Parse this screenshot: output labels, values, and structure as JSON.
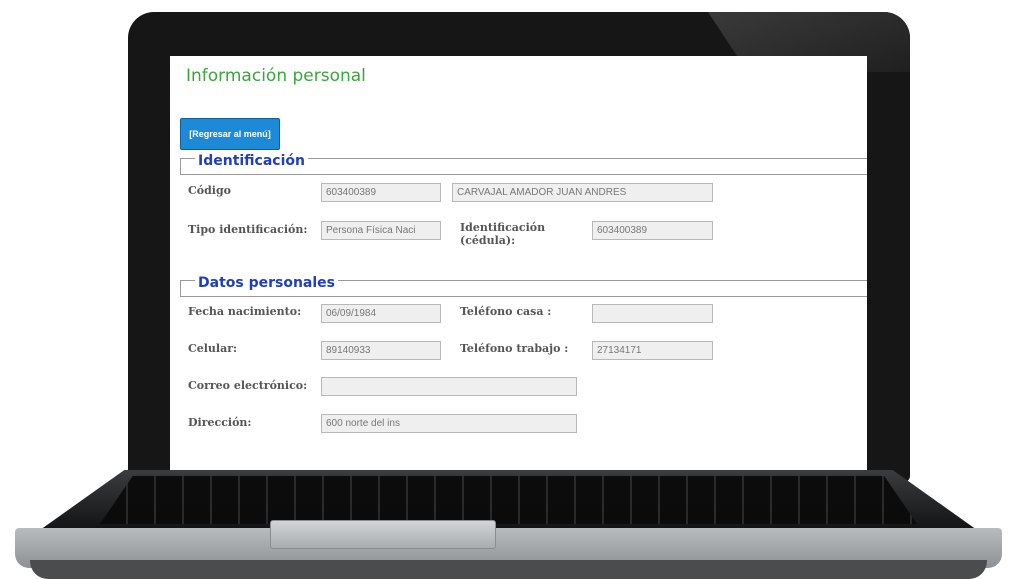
{
  "page": {
    "title": "Información personal",
    "back_button": "[Regresar al menú]"
  },
  "identificacion": {
    "title": "Identificación",
    "codigo_label": "Código",
    "codigo_value": "603400389",
    "nombre_value": "CARVAJAL AMADOR JUAN ANDRES",
    "tipo_label": "Tipo identificación:",
    "tipo_value": "Persona Física Naci",
    "identificacion_label": "Identificación (cédula):",
    "identificacion_value": "603400389"
  },
  "datos_personales": {
    "title": "Datos personales",
    "fecha_label": "Fecha nacimiento:",
    "fecha_value": "06/09/1984",
    "tel_casa_label": "Teléfono casa :",
    "tel_casa_value": "",
    "celular_label": "Celular:",
    "celular_value": "89140933",
    "tel_trabajo_label": "Teléfono trabajo :",
    "tel_trabajo_value": "27134171",
    "correo_label": "Correo electrónico:",
    "correo_value": "",
    "direccion_label": "Dirección:",
    "direccion_value": "600 norte del ins"
  }
}
